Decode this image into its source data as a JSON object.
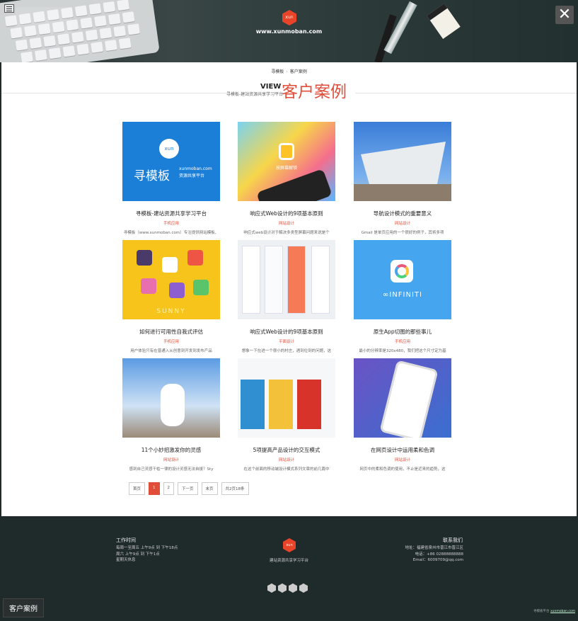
{
  "header": {
    "logo_text": "xun",
    "url": "www.xunmoban.com",
    "close_symbol": "✕"
  },
  "breadcrumb": [
    "寻模板",
    "客户案例"
  ],
  "section": {
    "title_en": "VIEW",
    "subtitle": "寻模板-建站资源共享学习平台",
    "title_cn": "客户案例"
  },
  "cards": [
    {
      "title": "寻模板-建站资源共享学习平台",
      "category": "手机应用",
      "desc": "寻模板（www.xunmoban.com）专注提供网站模板、",
      "thumb": {
        "logo": "xun",
        "big": "寻模板",
        "domain": "xunmoban.com",
        "tagline": "资源共享平台"
      }
    },
    {
      "title": "响应式Web设计的9项基本原则",
      "category": "网站设计",
      "desc": "响应式web设计对于解决多类型屏幕问题来说是个",
      "thumb": {
        "caption": "按屏幕解锁"
      }
    },
    {
      "title": "导航设计模式的重要意义",
      "category": "网站设计",
      "desc": "Gmail 是单页应用的一个很好的例子，其将多项"
    },
    {
      "title": "如何进行可用性自我式评估",
      "category": "手机应用",
      "desc": "用户体验只有在普通入从创意到开发到发布产品",
      "thumb": {
        "caption": "SUNNY"
      }
    },
    {
      "title": "响应式Web设计的9项基本原则",
      "category": "平面设计",
      "desc": "想象一下在进一个很小的村庄，遇到位到的问题，这"
    },
    {
      "title": "原生App切图的那些事儿",
      "category": "手机应用",
      "desc": "最小的分辨率是320x480，我们把这个尺寸定为基",
      "thumb": {
        "word": "∞INFINITI"
      }
    },
    {
      "title": "11个小妙招激发你的灵感",
      "category": "网站设计",
      "desc": "感到自己灵感干枯一律的设计灵感无法自拔？Sty"
    },
    {
      "title": "5项提高产品设计的交互模式",
      "category": "网站设计",
      "desc": "在这个前面的移动端设计模式系列文章的前几篇中"
    },
    {
      "title": "在网页设计中运用柔和色调",
      "category": "网站设计",
      "desc": "网页中的柔和色调的使用，不止是近来的趋势，这"
    }
  ],
  "pagination": [
    "首页",
    "1",
    "2",
    "下一页",
    "末页",
    "共2页18条"
  ],
  "footer": {
    "hours_title": "工作时间",
    "hours": [
      "每周一至周五 上午9点 到 下午18点",
      "周六 上午9点 到 下午1点",
      "星期天休息"
    ],
    "logo_text": "xun",
    "tagline": "建站资源共享学习平台",
    "contact_title": "联系我们",
    "contact": [
      "地址：福建省泉州市晋江市晋江区",
      "电话：+86 02888888888",
      "Email：6009709@qq.com"
    ],
    "copyright_prefix": "寻模板平台",
    "copyright_link": "xunmoban.com"
  },
  "bottom_label": "客户案例",
  "colors": {
    "accent": "#e04e3a",
    "footer_bg": "#1f2a2a"
  }
}
